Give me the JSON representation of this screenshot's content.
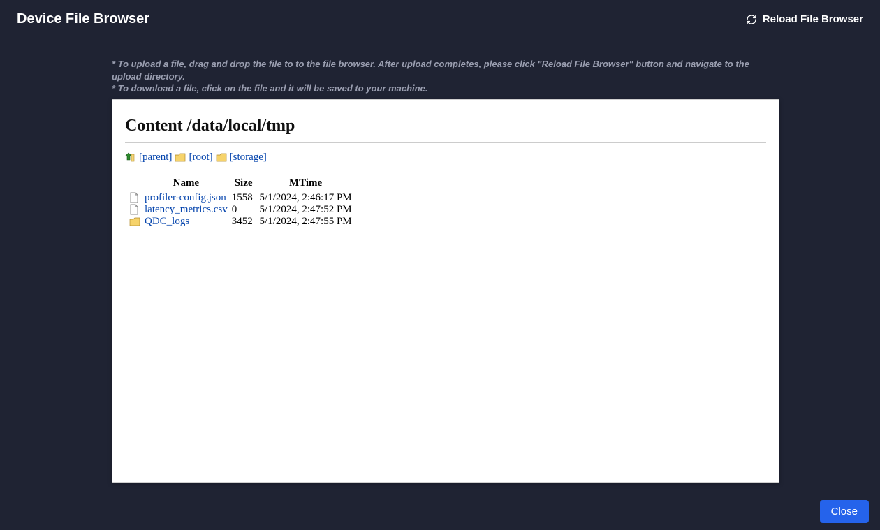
{
  "header": {
    "title": "Device File Browser",
    "reload_label": "Reload File Browser"
  },
  "instructions": {
    "line1": "* To upload a file, drag and drop the file to to the file browser. After upload completes, please click \"Reload File Browser\" button and navigate to the upload directory.",
    "line2": "* To download a file, click on the file and it will be saved to your machine."
  },
  "panel": {
    "heading_prefix": "Content ",
    "path": "/data/local/tmp",
    "nav": {
      "parent": "[parent]",
      "root": "[root]",
      "storage": "[storage]"
    },
    "columns": {
      "name": "Name",
      "size": "Size",
      "mtime": "MTime"
    },
    "rows": [
      {
        "type": "file",
        "name": "profiler-config.json",
        "size": "1558",
        "mtime": "5/1/2024, 2:46:17 PM"
      },
      {
        "type": "file",
        "name": "latency_metrics.csv",
        "size": "0",
        "mtime": "5/1/2024, 2:47:52 PM"
      },
      {
        "type": "folder",
        "name": "QDC_logs",
        "size": "3452",
        "mtime": "5/1/2024, 2:47:55 PM"
      }
    ]
  },
  "footer": {
    "close_label": "Close"
  }
}
